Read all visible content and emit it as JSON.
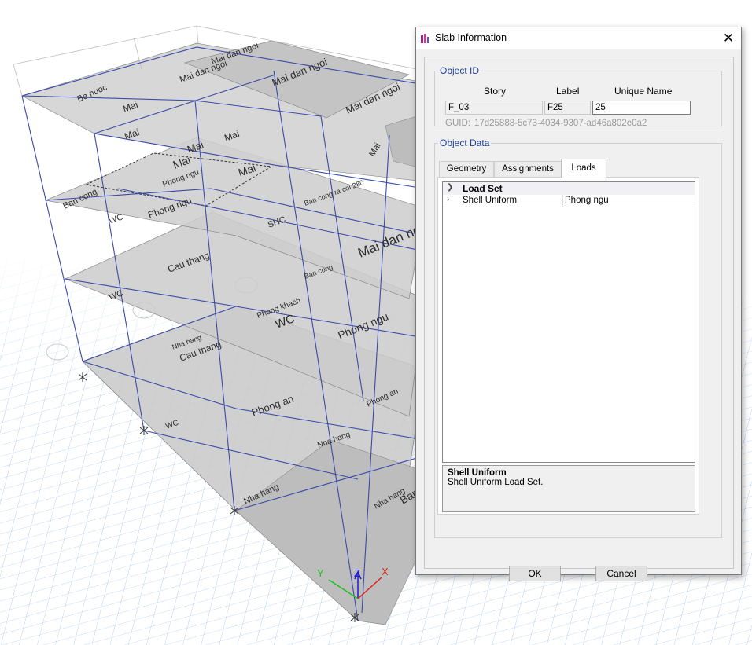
{
  "dialog": {
    "title": "Slab Information",
    "close_glyph": "✕",
    "object_id": {
      "legend": "Object ID",
      "columns": {
        "story": "Story",
        "label": "Label",
        "unique_name": "Unique Name"
      },
      "values": {
        "story": "F_03",
        "label": "F25",
        "unique_name": "25"
      },
      "guid_label": "GUID:",
      "guid_value": "17d25888-5c73-4034-9307-ad46a802e0a2"
    },
    "object_data": {
      "legend": "Object Data",
      "tabs": [
        "Geometry",
        "Assignments",
        "Loads"
      ],
      "active_tab": "Loads",
      "grid": {
        "category": "Load Set",
        "rows": [
          {
            "name": "Shell Uniform",
            "value": "Phong ngu"
          }
        ]
      },
      "help": {
        "title": "Shell Uniform",
        "text": "Shell Uniform Load Set."
      }
    },
    "buttons": {
      "ok": "OK",
      "cancel": "Cancel"
    }
  },
  "viewport": {
    "axis_labels": {
      "x": "X",
      "y": "Y",
      "z": "Z"
    },
    "axis_colors": {
      "x": "#e02020",
      "y": "#20c020",
      "z": "#1a1ad0"
    },
    "frame_color": "#3a4aa8",
    "slab_fill": "#c8c8c8",
    "grid_color": "#a9c9ee",
    "room_labels": [
      "Be nuoc",
      "Mai",
      "Mai dan ngoi",
      "Mai dan ngoi",
      "Mai dan ngoi",
      "Mai dan ngoi",
      "Mai",
      "Mai",
      "Mai",
      "Mai",
      "Mai",
      "Mai",
      "Phong ngu",
      "Ban cong",
      "WC",
      "Phong ngu",
      "Ban cong ra coi 280",
      "SHC",
      "Mai dan ngoi",
      "Cau thang",
      "WC",
      "Ban cong",
      "Phong khach",
      "WC",
      "Phong ngu",
      "Nha hang",
      "Cau thang",
      "Phong an",
      "Phong an",
      "WC",
      "Nha hang",
      "Nha hang",
      "Nha hang",
      "Ban"
    ]
  }
}
